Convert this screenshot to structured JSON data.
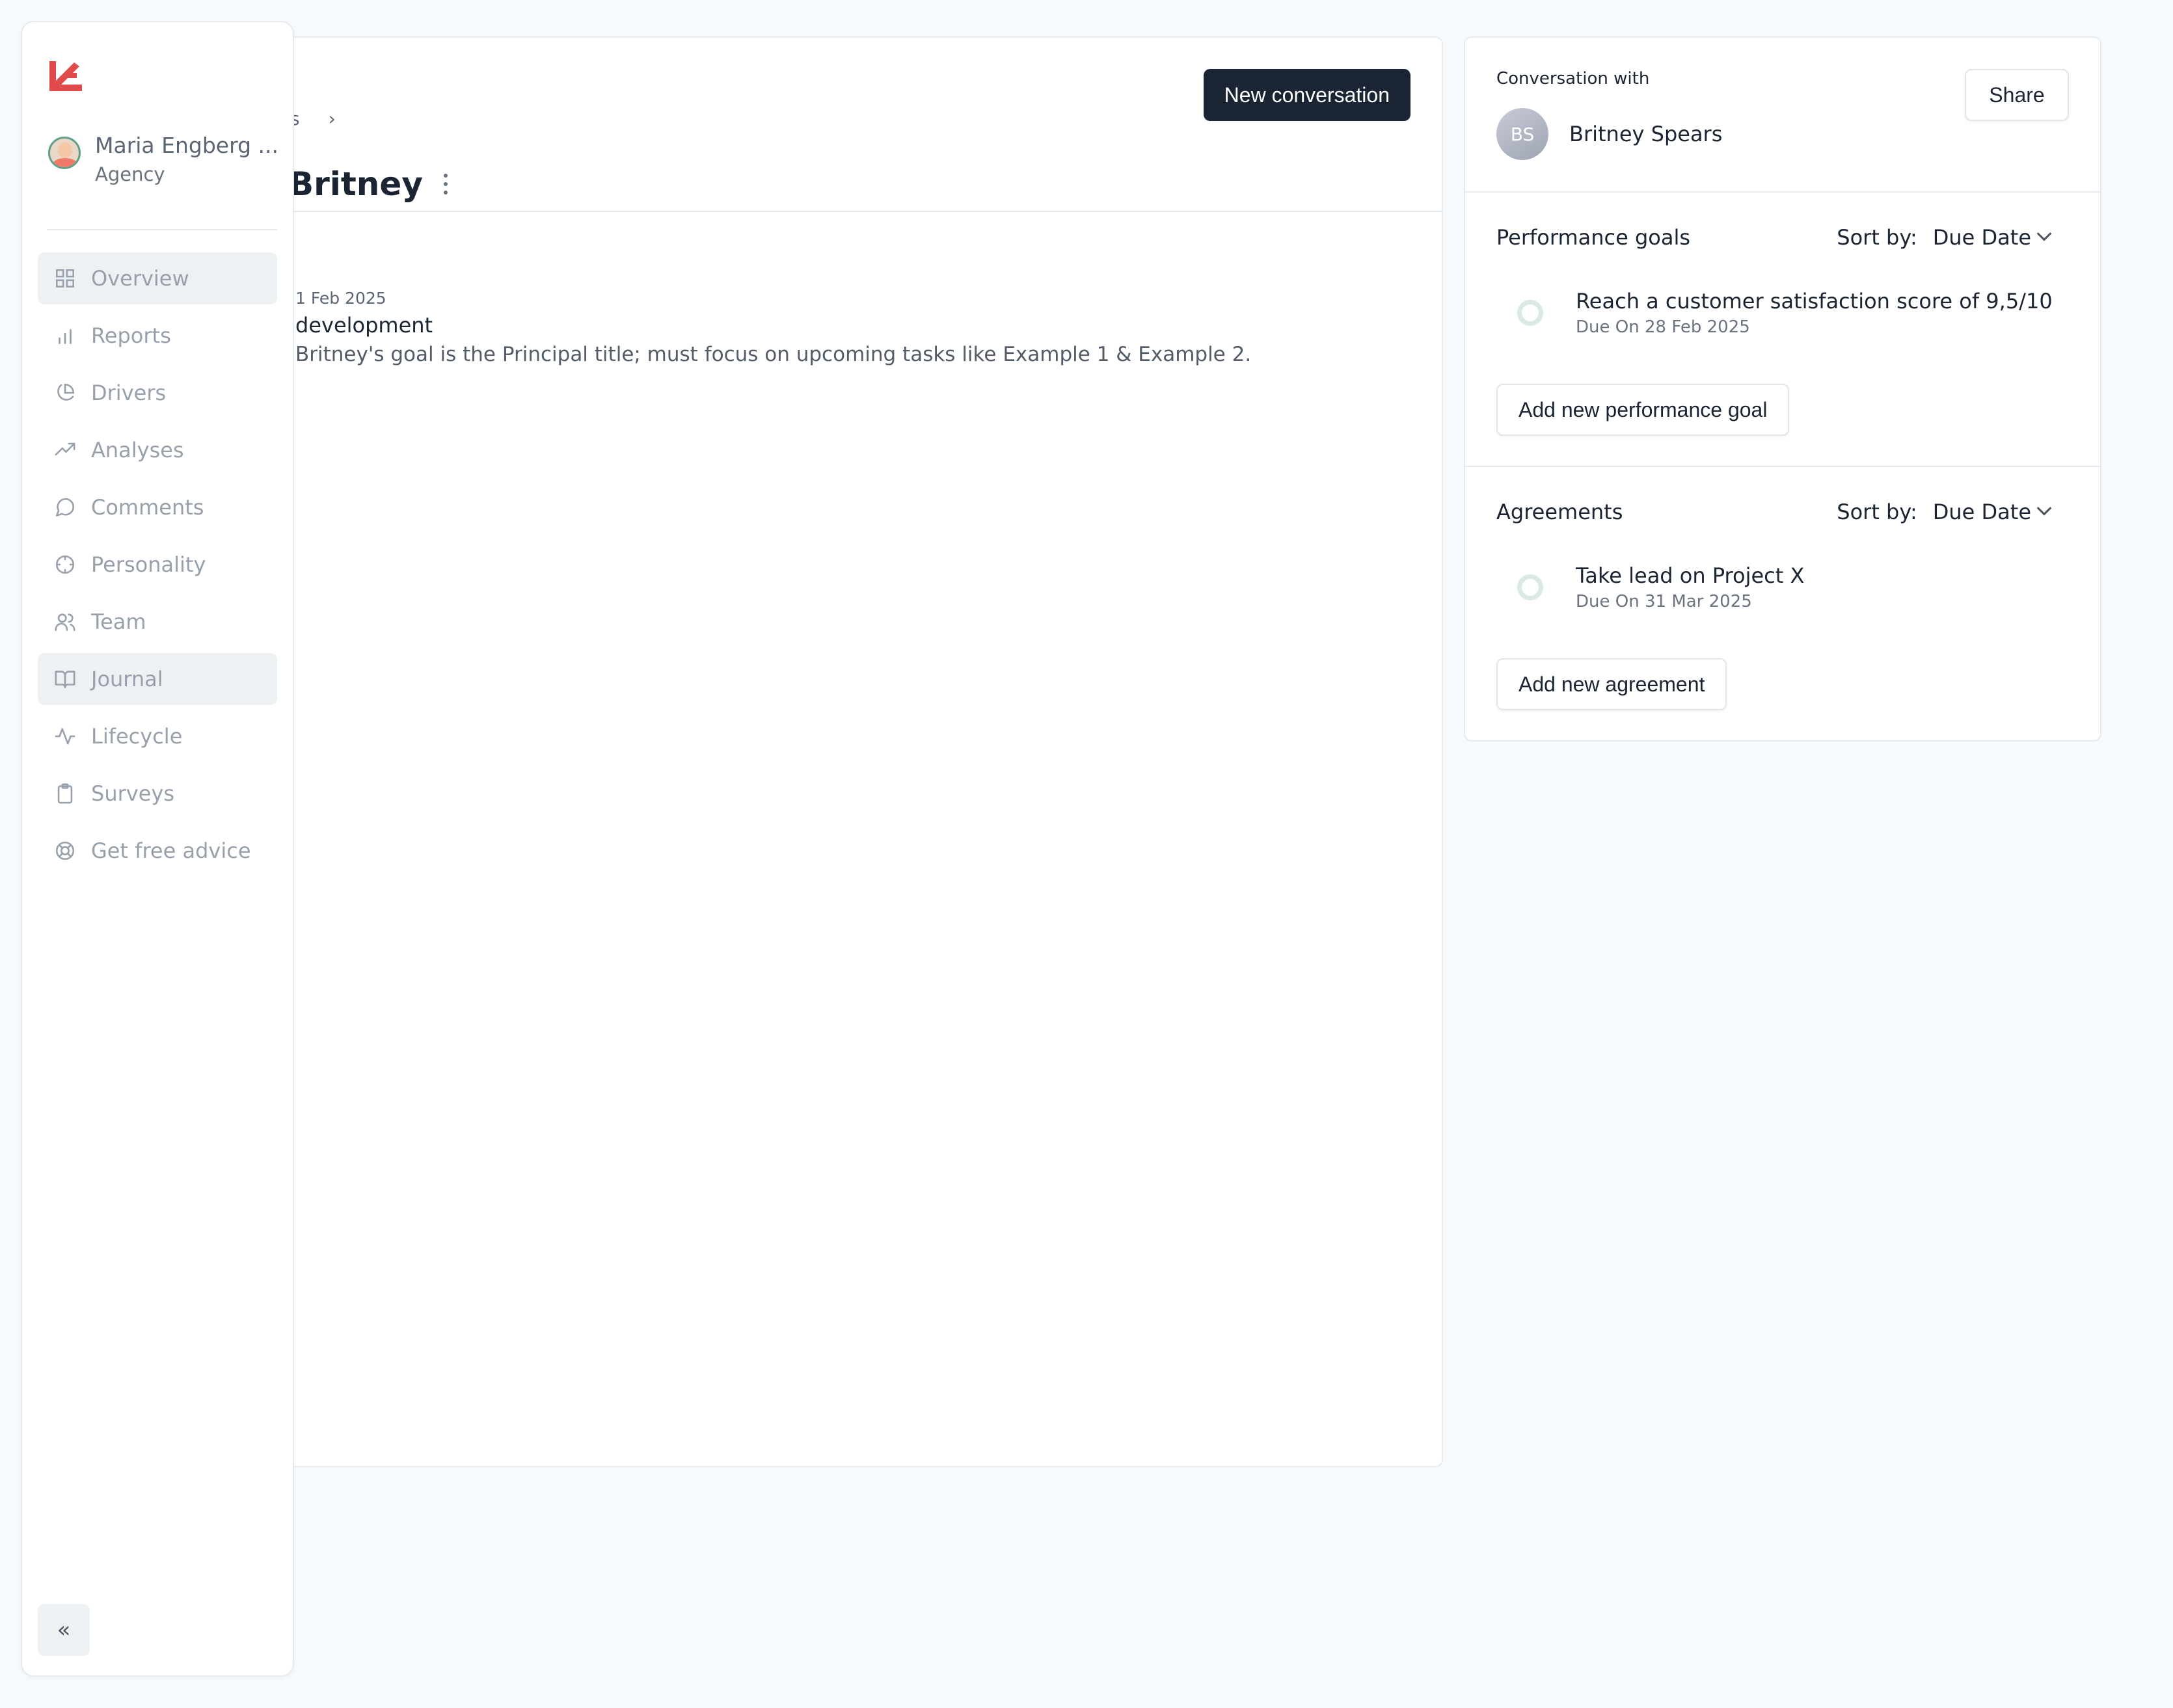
{
  "sidebar": {
    "user": {
      "name": "Maria Engberg ...",
      "role": "Agency"
    },
    "nav": [
      {
        "label": "Overview",
        "icon": "grid-icon",
        "active": true
      },
      {
        "label": "Reports",
        "icon": "bar-chart-icon",
        "active": false
      },
      {
        "label": "Drivers",
        "icon": "pie-chart-icon",
        "active": false
      },
      {
        "label": "Analyses",
        "icon": "trending-up-icon",
        "active": false
      },
      {
        "label": "Comments",
        "icon": "chat-bubble-icon",
        "active": false
      },
      {
        "label": "Personality",
        "icon": "compass-icon",
        "active": false
      },
      {
        "label": "Team",
        "icon": "users-icon",
        "active": false
      },
      {
        "label": "Journal",
        "icon": "book-open-icon",
        "active": true
      },
      {
        "label": "Lifecycle",
        "icon": "activity-icon",
        "active": false
      },
      {
        "label": "Surveys",
        "icon": "clipboard-icon",
        "active": false
      },
      {
        "label": "Get free advice",
        "icon": "life-buoy-icon",
        "active": false
      }
    ],
    "collapse_label": "«"
  },
  "main": {
    "breadcrumb": {
      "partial": "s",
      "separator": "›"
    },
    "title": "Britney",
    "new_conversation_label": "New conversation",
    "entry": {
      "date": "1 Feb 2025",
      "title": "development",
      "text": "Britney's goal is the Principal title; must focus on upcoming tasks like Example 1 & Example 2."
    }
  },
  "side": {
    "conversation_with_label": "Conversation with",
    "person": {
      "initials": "BS",
      "name": "Britney Spears"
    },
    "share_label": "Share",
    "goals": {
      "title": "Performance goals",
      "sort_label": "Sort by:",
      "sort_value": "Due Date",
      "items": [
        {
          "title": "Reach a customer satisfaction score of 9,5/10",
          "due": "Due On 28 Feb 2025"
        }
      ],
      "add_label": "Add new performance goal"
    },
    "agreements": {
      "title": "Agreements",
      "sort_label": "Sort by:",
      "sort_value": "Due Date",
      "items": [
        {
          "title": "Take lead on Project X",
          "due": "Due On 31 Mar 2025"
        }
      ],
      "add_label": "Add new agreement"
    }
  },
  "colors": {
    "primary_dark": "#1b2433",
    "logo_red": "#e24b4b",
    "muted_text": "#97a0ab",
    "ring_green": "#dbe9e6"
  }
}
